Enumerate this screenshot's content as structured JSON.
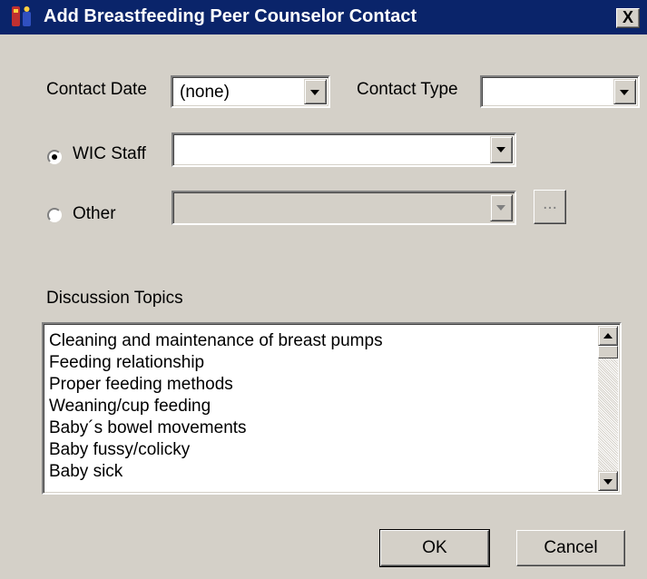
{
  "window": {
    "title": "Add Breastfeeding Peer Counselor Contact",
    "close_glyph": "X"
  },
  "colors": {
    "titlebar": "#0a246a",
    "face": "#d4d0c8",
    "window": "#ffffff"
  },
  "contact_date": {
    "label": "Contact Date",
    "value": "(none)"
  },
  "contact_type": {
    "label": "Contact Type",
    "value": ""
  },
  "wic_staff": {
    "label": "WIC Staff",
    "selected": true,
    "value": ""
  },
  "other": {
    "label": "Other",
    "selected": false,
    "value": "",
    "browse_label": "..."
  },
  "discussion": {
    "label": "Discussion Topics",
    "items": [
      "Cleaning and maintenance of breast pumps",
      "Feeding relationship",
      "Proper feeding methods",
      "Weaning/cup feeding",
      "Baby´s bowel movements",
      "Baby fussy/colicky",
      "Baby sick"
    ]
  },
  "buttons": {
    "ok": "OK",
    "cancel": "Cancel"
  },
  "icons": {
    "app": "baby-bottle-icon",
    "close": "close-icon",
    "dropdown": "chevron-down-icon"
  }
}
